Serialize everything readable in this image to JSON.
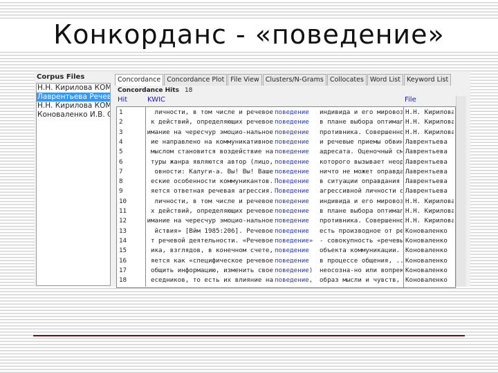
{
  "slide": {
    "title": "Конкорданс - «поведение»"
  },
  "corpus": {
    "label": "Corpus Files",
    "files": [
      "Н.Н. Кирилова КОМ",
      "Лаврентьева Речевы",
      "Н.Н. Кирилова КОМ",
      "Коноваленко И.В. Стр"
    ]
  },
  "tabs": [
    "Concordance",
    "Concordance Plot",
    "File View",
    "Clusters/N-Grams",
    "Collocates",
    "Word List",
    "Keyword List"
  ],
  "hits": {
    "label": "Concordance Hits",
    "count": "18"
  },
  "columns": {
    "hit": "Hit",
    "kwic": "KWIC",
    "file": "File"
  },
  "rows": [
    {
      "n": "1",
      "l": "личности, в том числе и речевое",
      "k": "поведение",
      "r": "индивида и его мировозз",
      "f": "Н.Н. Кирилова"
    },
    {
      "n": "2",
      "l": "к действий, определяющих речевое",
      "k": "поведение",
      "r": "в плане выбора оптималь",
      "f": "Н.Н. Кирилова"
    },
    {
      "n": "3",
      "l": "имание на чересчур эмоцио-нальное",
      "k": "поведение",
      "r": "противника. Совершенно",
      "f": "Н.Н. Кирилова"
    },
    {
      "n": "4",
      "l": "ие направлено на коммуникативное",
      "k": "поведение",
      "r": "и речевые приемы обвини",
      "f": "Лаврентьева"
    },
    {
      "n": "5",
      "l": "мыслом становится воздействие на",
      "k": "поведение",
      "r": "адресата. Оценочный смы",
      "f": "Лаврентьева"
    },
    {
      "n": "6",
      "l": "туры жанра являются автор (лицо,",
      "k": "поведение",
      "r": "которого вызывает неодо",
      "f": "Лаврентьева"
    },
    {
      "n": "7",
      "l": "овности: Калуги-а. Вы! Вы! Ваше",
      "k": "поведение",
      "r": "ничто не может оправдат",
      "f": "Лаврентьева"
    },
    {
      "n": "8",
      "l": "еские особенности коммуникантов.",
      "k": "Поведение",
      "r": "в ситуации оправдания о",
      "f": "Лаврентьева"
    },
    {
      "n": "9",
      "l": "яется ответная речевая агрессия.",
      "k": "Поведение",
      "r": "агрессивной личности об",
      "f": "Лаврентьева"
    },
    {
      "n": "10",
      "l": "личности, в том числе и речевое",
      "k": "поведение",
      "r": "индивида и его мировозз",
      "f": "Н.Н. Кирилова"
    },
    {
      "n": "11",
      "l": "х действий, определяющих речевое",
      "k": "поведение",
      "r": "в плане выбора оптималь",
      "f": "Н.Н. Кирилова"
    },
    {
      "n": "12",
      "l": "имание на чересчур эмоцио-нальное",
      "k": "поведение",
      "r": "противника. Совершенно",
      "f": "Н.Н. Кирилова"
    },
    {
      "n": "13",
      "l": "йствия» [Вйм 1985:206]. Речевое",
      "k": "поведение",
      "r": "есть производное от реч",
      "f": "Коноваленко"
    },
    {
      "n": "14",
      "l": "т речевой деятельности. «Речевое",
      "k": "поведение»",
      "r": "- совокупность «речевы",
      "f": "Коноваленко"
    },
    {
      "n": "15",
      "l": "ика, взглядов, в конечном счете,",
      "k": "поведение",
      "r": "объекта коммуникации. К",
      "f": "Коноваленко"
    },
    {
      "n": "16",
      "l": "яется как «специфическое речевое",
      "k": "поведение",
      "r": "в процессе общения, ... ",
      "f": "Коноваленко"
    },
    {
      "n": "17",
      "l": "общить информацию, изменить свое",
      "k": "поведение)",
      "r": "неосозна-но или вопрек",
      "f": "Коноваленко"
    },
    {
      "n": "18",
      "l": "еседников, то есть их влияние на",
      "k": "поведение,",
      "r": "образ мысли и чувств,",
      "f": "Коноваленко"
    }
  ]
}
